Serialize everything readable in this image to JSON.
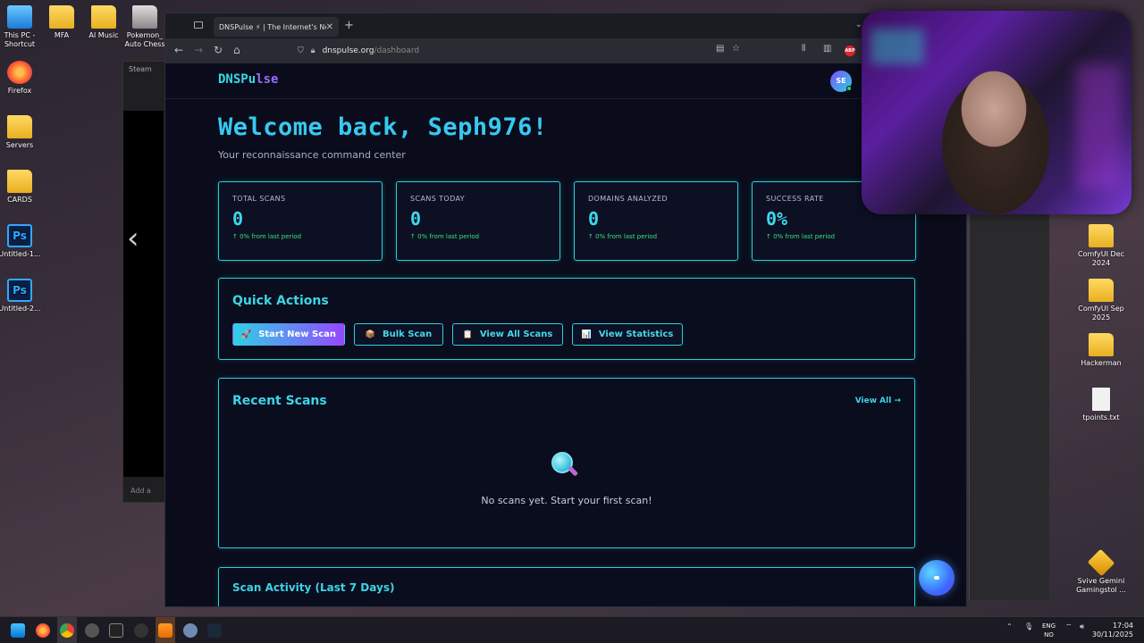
{
  "desktop": {
    "left_icons": [
      {
        "label": "This PC - Shortcut",
        "icon": "pc-icon"
      },
      {
        "label": "MFA",
        "icon": "folder-icon"
      },
      {
        "label": "AI Music",
        "icon": "folder-icon"
      },
      {
        "label": "Pokemon_ Auto Chess",
        "icon": "game-icon"
      },
      {
        "label": "Firefox",
        "icon": "firefox-icon"
      },
      {
        "label": "Servers",
        "icon": "folder-icon"
      },
      {
        "label": "CARDS",
        "icon": "folder-icon"
      },
      {
        "label": "Untitled-1...",
        "icon": "photoshop-icon"
      },
      {
        "label": "Untitled-2...",
        "icon": "photoshop-icon"
      }
    ],
    "right_icons": [
      {
        "label": "ComfyUI Dec 2024",
        "icon": "folder-icon"
      },
      {
        "label": "ComfyUI Sep 2025",
        "icon": "folder-icon"
      },
      {
        "label": "Hackerman",
        "icon": "folder-icon"
      },
      {
        "label": "tpoints.txt",
        "icon": "text-file-icon"
      },
      {
        "label": "Svive Gemini Gamingstol ...",
        "icon": "shortcut-icon"
      }
    ],
    "bg_window": {
      "tab": "Steam",
      "add_text": "Add a"
    }
  },
  "browser": {
    "tab_title": "DNSPulse ⚡ | The Internet's Nervo",
    "url_host": "dnspulse.org",
    "url_path": "/dashboard"
  },
  "app": {
    "logo_main": "DNSPu",
    "logo_accent": "lse",
    "avatar_initials": "SE",
    "welcome": "Welcome back, Seph976!",
    "subtitle": "Your reconnaissance command center",
    "stats": [
      {
        "label": "TOTAL SCANS",
        "value": "0",
        "change": "↑ 0% from last period"
      },
      {
        "label": "SCANS TODAY",
        "value": "0",
        "change": "↑ 0% from last period"
      },
      {
        "label": "DOMAINS ANALYZED",
        "value": "0",
        "change": "↑ 0% from last period"
      },
      {
        "label": "SUCCESS RATE",
        "value": "0%",
        "change": "↑ 0% from last period"
      }
    ],
    "quick_actions": {
      "title": "Quick Actions",
      "buttons": [
        {
          "icon": "🚀",
          "label": "Start New Scan"
        },
        {
          "icon": "📦",
          "label": "Bulk Scan"
        },
        {
          "icon": "📋",
          "label": "View All Scans"
        },
        {
          "icon": "📊",
          "label": "View Statistics"
        }
      ]
    },
    "recent_scans": {
      "title": "Recent Scans",
      "view_all": "View All →",
      "empty_text": "No scans yet. Start your first scan!"
    },
    "activity": {
      "title": "Scan Activity (Last 7 Days)"
    }
  },
  "taskbar": {
    "lang_top": "ENG",
    "lang_bottom": "NO",
    "time": "17:04",
    "date": "30/11/2025"
  },
  "colors": {
    "accent_cyan": "#2ad0d9",
    "accent_purple": "#9448ff",
    "success_green": "#3be07a",
    "page_bg": "#0a0c1b"
  }
}
